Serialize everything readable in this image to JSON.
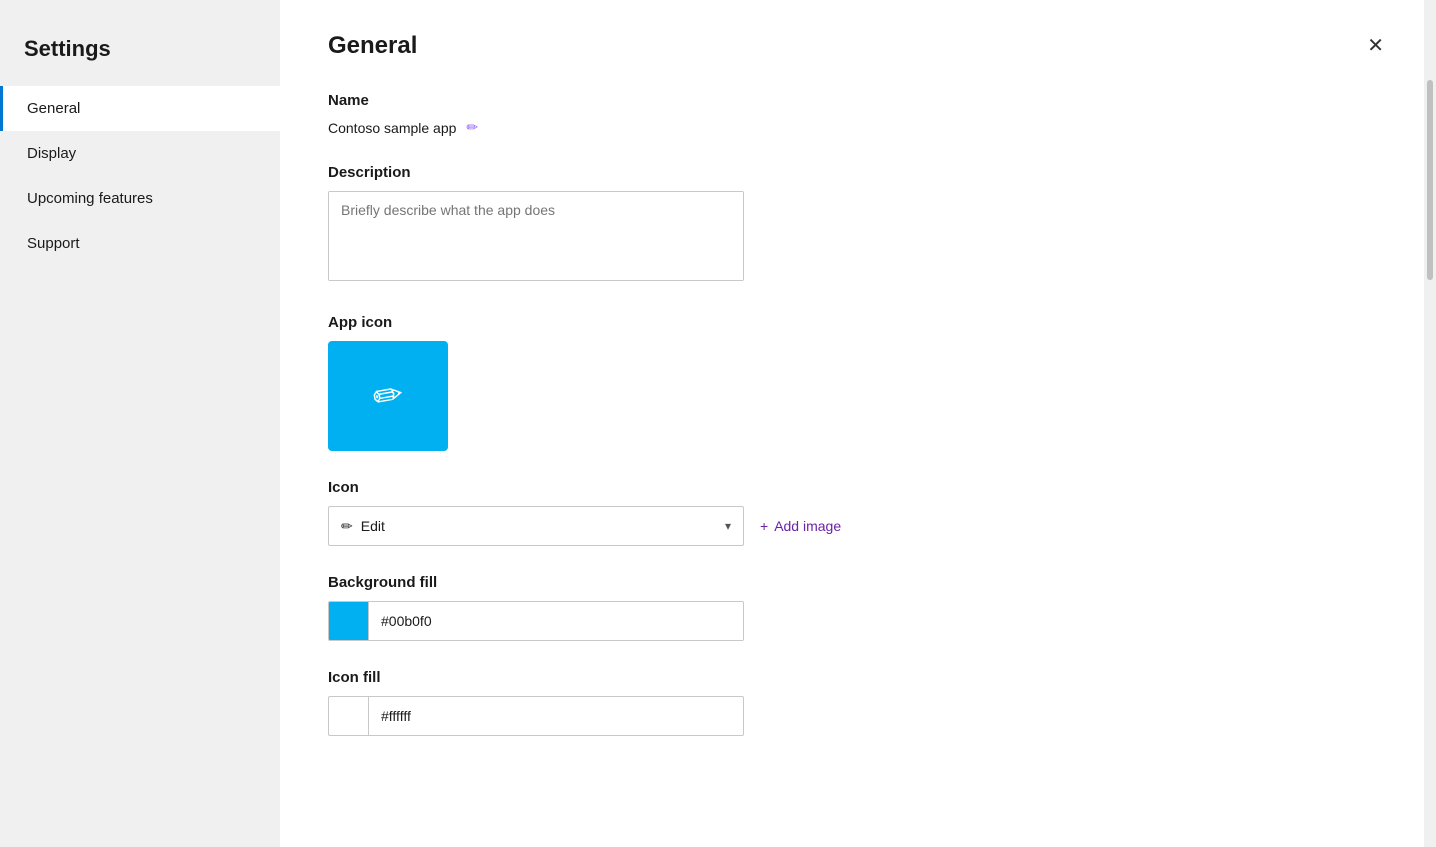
{
  "sidebar": {
    "title": "Settings",
    "items": [
      {
        "id": "general",
        "label": "General",
        "active": true
      },
      {
        "id": "display",
        "label": "Display",
        "active": false
      },
      {
        "id": "upcoming-features",
        "label": "Upcoming features",
        "active": false
      },
      {
        "id": "support",
        "label": "Support",
        "active": false
      }
    ]
  },
  "page": {
    "title": "General",
    "close_label": "✕"
  },
  "form": {
    "name_label": "Name",
    "name_value": "Contoso sample app",
    "description_label": "Description",
    "description_placeholder": "Briefly describe what the app does",
    "app_icon_label": "App icon",
    "icon_label": "Icon",
    "icon_selected": "Edit",
    "add_image_label": "Add image",
    "background_fill_label": "Background fill",
    "background_fill_value": "#00b0f0",
    "icon_fill_label": "Icon fill",
    "icon_fill_value": "#ffffff"
  },
  "colors": {
    "background_swatch": "#00b0f0",
    "icon_swatch": "#ffffff",
    "app_icon_bg": "#00b0f0"
  },
  "icons": {
    "edit_pencil": "✏",
    "pencil_small": "✏",
    "chevron_down": "▾",
    "plus": "+",
    "close": "✕"
  }
}
